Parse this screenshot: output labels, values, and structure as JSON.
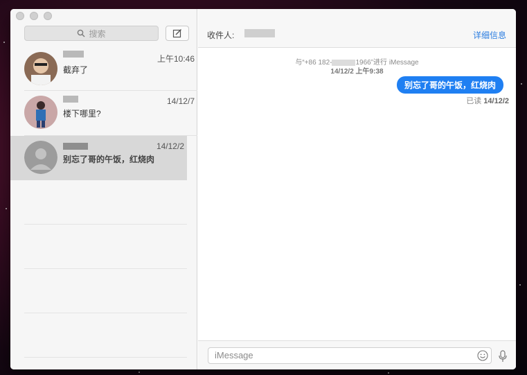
{
  "sidebar": {
    "search_placeholder": "搜索",
    "conversations": [
      {
        "time": "上午10:46",
        "preview": "截弃了"
      },
      {
        "time": "14/12/7",
        "preview": "楼下哪里?"
      },
      {
        "time": "14/12/2",
        "preview": "别忘了哥的午饭，红烧肉"
      }
    ]
  },
  "header": {
    "recipient_label": "收件人:",
    "details_label": "详细信息"
  },
  "thread": {
    "meta_prefix": "与“+86 182-",
    "meta_suffix": "1966”进行 iMessage",
    "meta_time": "14/12/2 上午9:38",
    "message": "别忘了哥的午饭，红烧肉",
    "read_prefix": "已读",
    "read_time": "14/12/2"
  },
  "composer": {
    "placeholder": "iMessage"
  },
  "icons": {
    "search": "search-icon",
    "compose": "compose-icon",
    "emoji": "emoji-icon",
    "mic": "microphone-icon"
  },
  "colors": {
    "accent": "#1f7ff2",
    "link": "#2b7de0"
  }
}
